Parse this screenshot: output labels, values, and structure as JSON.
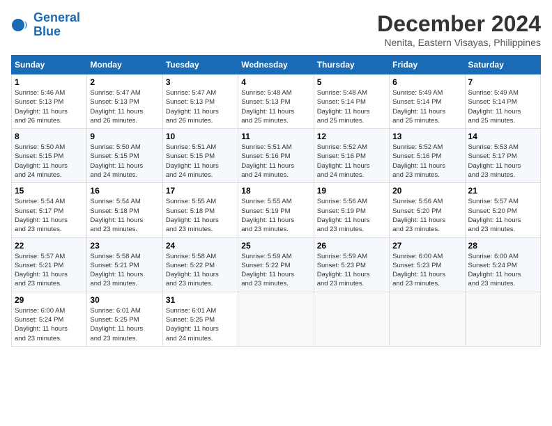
{
  "header": {
    "logo_line1": "General",
    "logo_line2": "Blue",
    "month": "December 2024",
    "location": "Nenita, Eastern Visayas, Philippines"
  },
  "weekdays": [
    "Sunday",
    "Monday",
    "Tuesday",
    "Wednesday",
    "Thursday",
    "Friday",
    "Saturday"
  ],
  "weeks": [
    [
      {
        "day": "1",
        "info": "Sunrise: 5:46 AM\nSunset: 5:13 PM\nDaylight: 11 hours\nand 26 minutes."
      },
      {
        "day": "2",
        "info": "Sunrise: 5:47 AM\nSunset: 5:13 PM\nDaylight: 11 hours\nand 26 minutes."
      },
      {
        "day": "3",
        "info": "Sunrise: 5:47 AM\nSunset: 5:13 PM\nDaylight: 11 hours\nand 26 minutes."
      },
      {
        "day": "4",
        "info": "Sunrise: 5:48 AM\nSunset: 5:13 PM\nDaylight: 11 hours\nand 25 minutes."
      },
      {
        "day": "5",
        "info": "Sunrise: 5:48 AM\nSunset: 5:14 PM\nDaylight: 11 hours\nand 25 minutes."
      },
      {
        "day": "6",
        "info": "Sunrise: 5:49 AM\nSunset: 5:14 PM\nDaylight: 11 hours\nand 25 minutes."
      },
      {
        "day": "7",
        "info": "Sunrise: 5:49 AM\nSunset: 5:14 PM\nDaylight: 11 hours\nand 25 minutes."
      }
    ],
    [
      {
        "day": "8",
        "info": "Sunrise: 5:50 AM\nSunset: 5:15 PM\nDaylight: 11 hours\nand 24 minutes."
      },
      {
        "day": "9",
        "info": "Sunrise: 5:50 AM\nSunset: 5:15 PM\nDaylight: 11 hours\nand 24 minutes."
      },
      {
        "day": "10",
        "info": "Sunrise: 5:51 AM\nSunset: 5:15 PM\nDaylight: 11 hours\nand 24 minutes."
      },
      {
        "day": "11",
        "info": "Sunrise: 5:51 AM\nSunset: 5:16 PM\nDaylight: 11 hours\nand 24 minutes."
      },
      {
        "day": "12",
        "info": "Sunrise: 5:52 AM\nSunset: 5:16 PM\nDaylight: 11 hours\nand 24 minutes."
      },
      {
        "day": "13",
        "info": "Sunrise: 5:52 AM\nSunset: 5:16 PM\nDaylight: 11 hours\nand 23 minutes."
      },
      {
        "day": "14",
        "info": "Sunrise: 5:53 AM\nSunset: 5:17 PM\nDaylight: 11 hours\nand 23 minutes."
      }
    ],
    [
      {
        "day": "15",
        "info": "Sunrise: 5:54 AM\nSunset: 5:17 PM\nDaylight: 11 hours\nand 23 minutes."
      },
      {
        "day": "16",
        "info": "Sunrise: 5:54 AM\nSunset: 5:18 PM\nDaylight: 11 hours\nand 23 minutes."
      },
      {
        "day": "17",
        "info": "Sunrise: 5:55 AM\nSunset: 5:18 PM\nDaylight: 11 hours\nand 23 minutes."
      },
      {
        "day": "18",
        "info": "Sunrise: 5:55 AM\nSunset: 5:19 PM\nDaylight: 11 hours\nand 23 minutes."
      },
      {
        "day": "19",
        "info": "Sunrise: 5:56 AM\nSunset: 5:19 PM\nDaylight: 11 hours\nand 23 minutes."
      },
      {
        "day": "20",
        "info": "Sunrise: 5:56 AM\nSunset: 5:20 PM\nDaylight: 11 hours\nand 23 minutes."
      },
      {
        "day": "21",
        "info": "Sunrise: 5:57 AM\nSunset: 5:20 PM\nDaylight: 11 hours\nand 23 minutes."
      }
    ],
    [
      {
        "day": "22",
        "info": "Sunrise: 5:57 AM\nSunset: 5:21 PM\nDaylight: 11 hours\nand 23 minutes."
      },
      {
        "day": "23",
        "info": "Sunrise: 5:58 AM\nSunset: 5:21 PM\nDaylight: 11 hours\nand 23 minutes."
      },
      {
        "day": "24",
        "info": "Sunrise: 5:58 AM\nSunset: 5:22 PM\nDaylight: 11 hours\nand 23 minutes."
      },
      {
        "day": "25",
        "info": "Sunrise: 5:59 AM\nSunset: 5:22 PM\nDaylight: 11 hours\nand 23 minutes."
      },
      {
        "day": "26",
        "info": "Sunrise: 5:59 AM\nSunset: 5:23 PM\nDaylight: 11 hours\nand 23 minutes."
      },
      {
        "day": "27",
        "info": "Sunrise: 6:00 AM\nSunset: 5:23 PM\nDaylight: 11 hours\nand 23 minutes."
      },
      {
        "day": "28",
        "info": "Sunrise: 6:00 AM\nSunset: 5:24 PM\nDaylight: 11 hours\nand 23 minutes."
      }
    ],
    [
      {
        "day": "29",
        "info": "Sunrise: 6:00 AM\nSunset: 5:24 PM\nDaylight: 11 hours\nand 23 minutes."
      },
      {
        "day": "30",
        "info": "Sunrise: 6:01 AM\nSunset: 5:25 PM\nDaylight: 11 hours\nand 23 minutes."
      },
      {
        "day": "31",
        "info": "Sunrise: 6:01 AM\nSunset: 5:25 PM\nDaylight: 11 hours\nand 24 minutes."
      },
      {
        "day": "",
        "info": ""
      },
      {
        "day": "",
        "info": ""
      },
      {
        "day": "",
        "info": ""
      },
      {
        "day": "",
        "info": ""
      }
    ]
  ]
}
